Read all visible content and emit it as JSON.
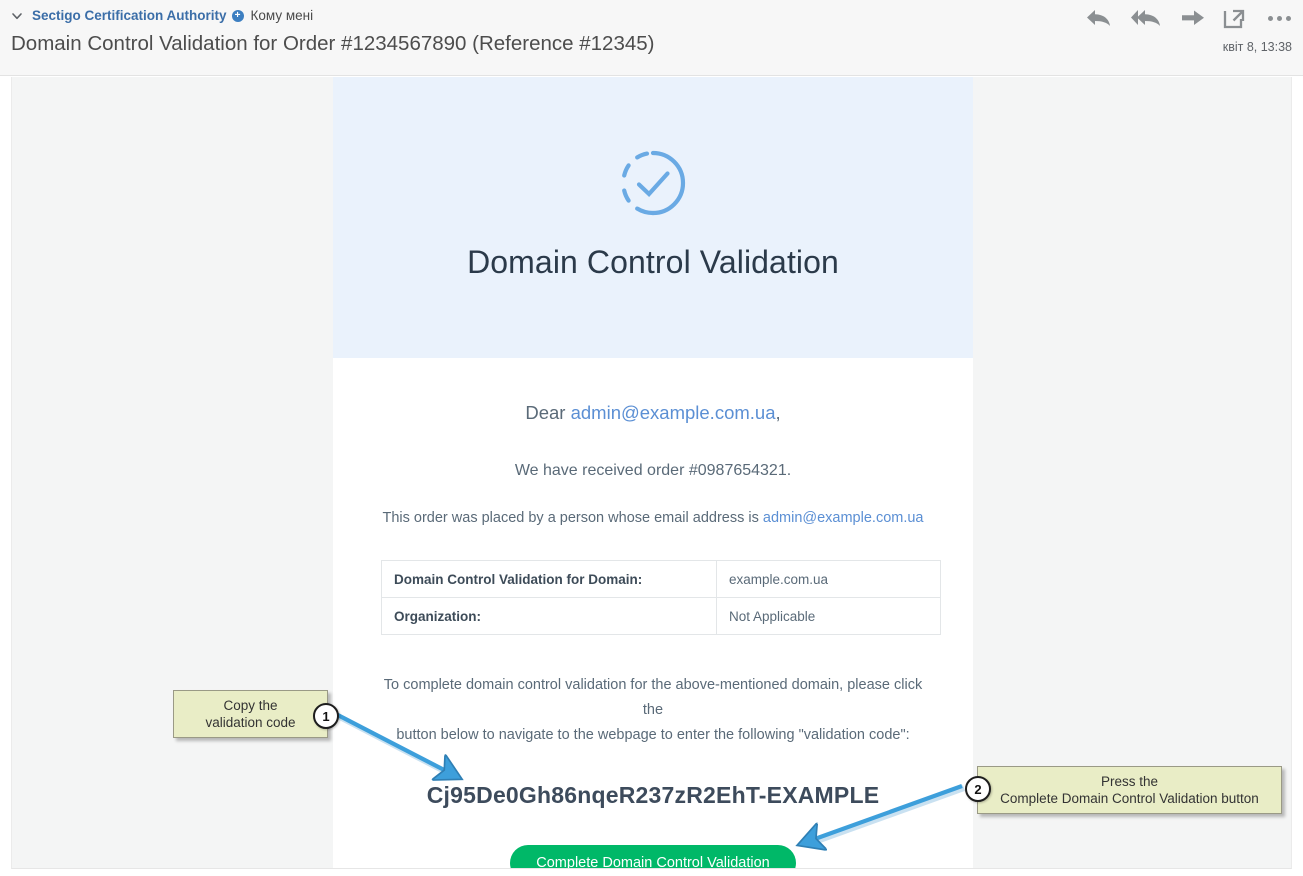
{
  "mail_header": {
    "chevron_icon": "chevron-down-icon",
    "sender": "Sectigo Certification Authority",
    "add_contact_icon": "add-contact-plus-icon",
    "recipient": "Кому мені",
    "subject": "Domain Control Validation for Order #1234567890 (Reference #12345)",
    "timestamp": "квіт 8, 13:38",
    "actions": [
      {
        "name": "reply-icon",
        "label": "Reply"
      },
      {
        "name": "reply-all-icon",
        "label": "Reply all"
      },
      {
        "name": "forward-icon",
        "label": "Forward"
      },
      {
        "name": "open-in-new-window-icon",
        "label": "Open in new window"
      },
      {
        "name": "more-options-icon",
        "label": "More"
      }
    ]
  },
  "email": {
    "hero": {
      "icon": "check-circle-dashed-icon",
      "title": "Domain Control Validation",
      "bg_color": "#eaf2fc",
      "icon_color": "#6aaae4"
    },
    "greeting_prefix": "Dear ",
    "greeting_email": "admin@example.com.ua",
    "greeting_suffix": ",",
    "order_line": "We have received order #0987654321.",
    "placed_by_prefix": "This order was placed by a person whose email address is ",
    "placed_by_email": "admin@example.com.ua",
    "table": {
      "rows": [
        {
          "key": "Domain Control Validation for Domain:",
          "value": "example.com.ua"
        },
        {
          "key": "Organization:",
          "value": "Not Applicable"
        }
      ]
    },
    "instructions_line1": "To complete domain control validation for the above-mentioned domain, please click the",
    "instructions_line2": "button below to navigate to the webpage to enter the following \"validation code\":",
    "validation_code": "Cj95De0Gh86nqeR237zR2EhT-EXAMPLE",
    "cta_label": "Complete Domain Control Validation",
    "cta_color": "#00b868"
  },
  "annotations": {
    "arrow_color": "#3d9fdb",
    "callout_bg": "#e9edc6",
    "items": [
      {
        "badge": "1",
        "text": "Copy the\nvalidation code"
      },
      {
        "badge": "2",
        "text": "Press the\nComplete Domain Control Validation button"
      }
    ]
  }
}
